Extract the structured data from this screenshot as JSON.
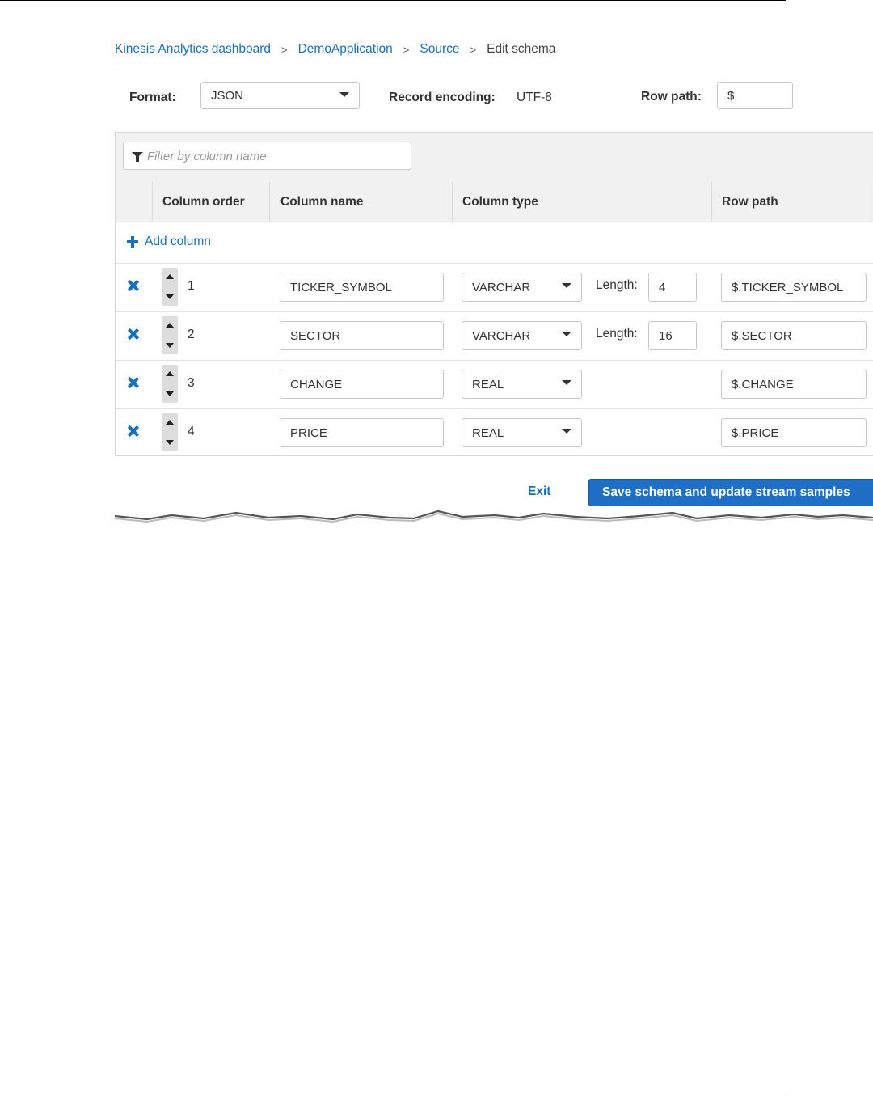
{
  "breadcrumb": {
    "items": [
      "Kinesis Analytics dashboard",
      "DemoApplication",
      "Source"
    ],
    "current": "Edit schema"
  },
  "format": {
    "format_label": "Format:",
    "format_value": "JSON",
    "encoding_label": "Record encoding:",
    "encoding_value": "UTF-8",
    "rowpath_label": "Row path:",
    "rowpath_value": "$"
  },
  "filter": {
    "placeholder": "Filter by column name"
  },
  "table": {
    "headers": [
      "Column order",
      "Column name",
      "Column type",
      "Row path"
    ],
    "add_column": "Add column",
    "length_label": "Length:",
    "rows": [
      {
        "order": "1",
        "name": "TICKER_SYMBOL",
        "type": "VARCHAR",
        "length": "4",
        "path": "$.TICKER_SYMBOL"
      },
      {
        "order": "2",
        "name": "SECTOR",
        "type": "VARCHAR",
        "length": "16",
        "path": "$.SECTOR"
      },
      {
        "order": "3",
        "name": "CHANGE",
        "type": "REAL",
        "length": "",
        "path": "$.CHANGE"
      },
      {
        "order": "4",
        "name": "PRICE",
        "type": "REAL",
        "length": "",
        "path": "$.PRICE"
      }
    ]
  },
  "actions": {
    "exit": "Exit",
    "save": "Save schema and update stream samples"
  },
  "colors": {
    "link": "#1a6fb8",
    "primary_button": "#1f6fc6"
  }
}
